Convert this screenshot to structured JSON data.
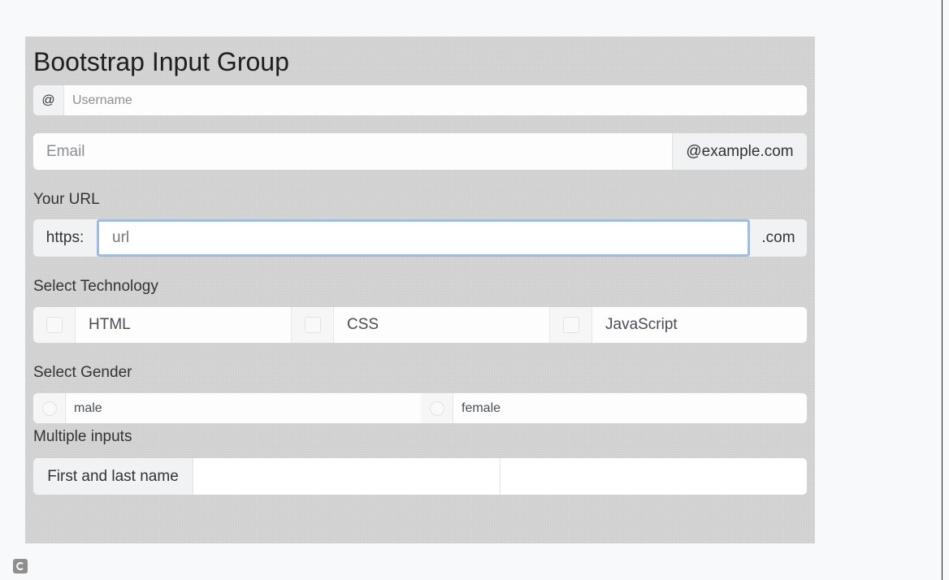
{
  "page": {
    "title": "Bootstrap Input Group"
  },
  "username": {
    "addon": "@",
    "placeholder": "Username"
  },
  "email": {
    "placeholder": "Email",
    "addon": "@example.com"
  },
  "url": {
    "label": "Your URL",
    "prefix": "https:",
    "placeholder": "url",
    "suffix": ".com"
  },
  "technology": {
    "label": "Select Technology",
    "options": [
      "HTML",
      "CSS",
      "JavaScript"
    ]
  },
  "gender": {
    "label": "Select Gender",
    "options": [
      "male",
      "female"
    ]
  },
  "multiple": {
    "label": "Multiple inputs",
    "addon": "First and last name",
    "first_value": "",
    "last_value": ""
  },
  "colors": {
    "focus_border": "#9dbbe6",
    "panel_background": "#d4d4d4"
  },
  "icons": {
    "corner": "corner-app-icon"
  }
}
